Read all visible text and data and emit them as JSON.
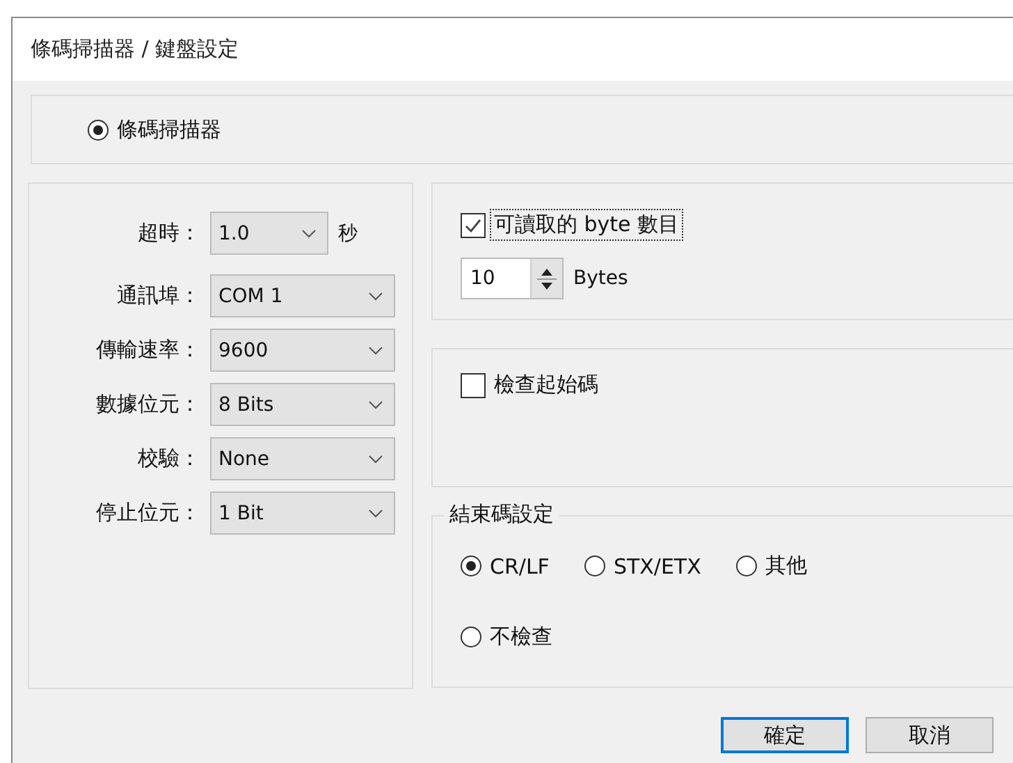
{
  "window": {
    "title": "條碼掃描器 / 鍵盤設定"
  },
  "mode_radio": {
    "label": "條碼掃描器",
    "selected": true
  },
  "serial_settings": [
    {
      "label": "超時：",
      "value": "1.0",
      "unit": "秒"
    },
    {
      "label": "通訊埠：",
      "value": "COM 1"
    },
    {
      "label": "傳輸速率：",
      "value": "9600"
    },
    {
      "label": "數據位元：",
      "value": "8 Bits"
    },
    {
      "label": "校驗：",
      "value": "None"
    },
    {
      "label": "停止位元：",
      "value": "1 Bit"
    }
  ],
  "byte_count": {
    "label": "可讀取的 byte 數目",
    "checked": true,
    "focused": true,
    "value": "10",
    "unit": "Bytes"
  },
  "start_code": {
    "label": "檢查起始碼",
    "checked": false
  },
  "end_code": {
    "title": "結束碼設定",
    "options": [
      {
        "label": "CR/LF",
        "selected": true
      },
      {
        "label": "STX/ETX",
        "selected": false
      },
      {
        "label": "其他",
        "selected": false
      },
      {
        "label": "不檢查",
        "selected": false
      }
    ]
  },
  "buttons": [
    {
      "label": "確定",
      "focused": true
    },
    {
      "label": "取消",
      "focused": false
    }
  ]
}
